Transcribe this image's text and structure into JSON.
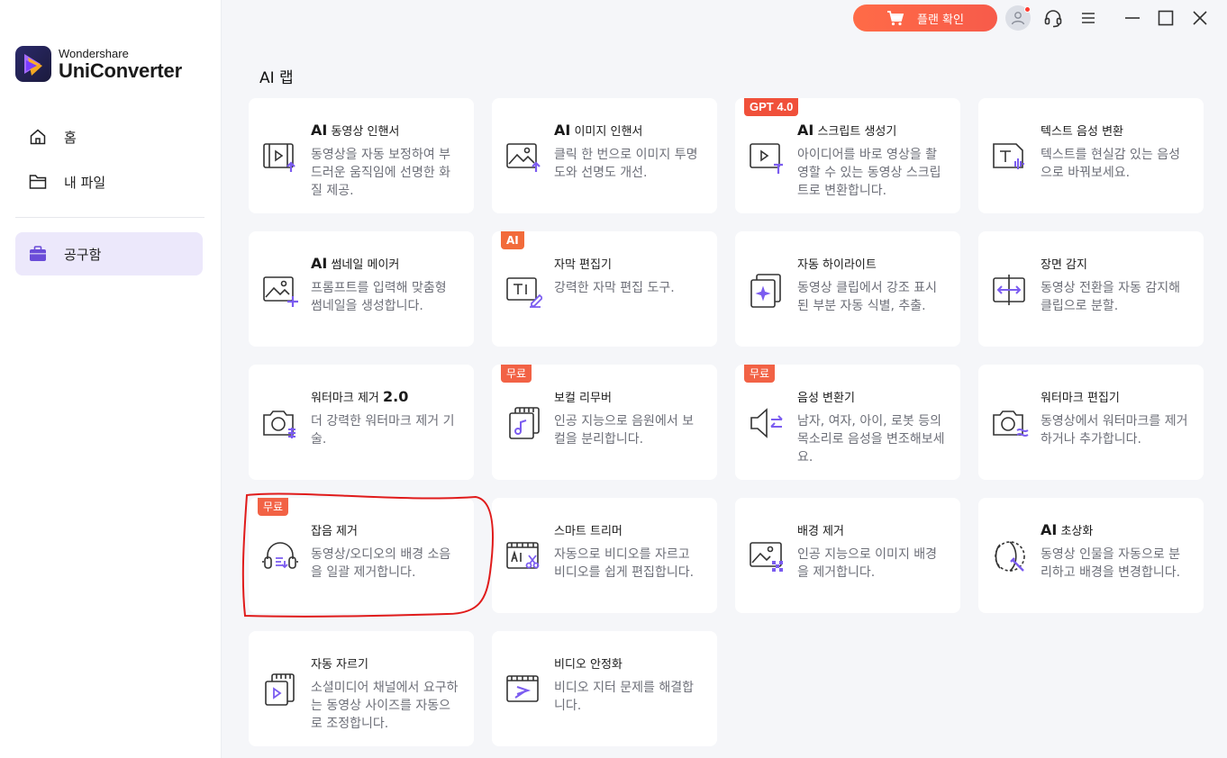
{
  "app": {
    "brand": "Wondershare",
    "product": "UniConverter"
  },
  "sidebar": {
    "items": [
      {
        "label": "홈",
        "icon": "home-icon"
      },
      {
        "label": "내 파일",
        "icon": "folder-icon"
      },
      {
        "label": "공구함",
        "icon": "toolbox-icon",
        "active": true
      }
    ]
  },
  "topbar": {
    "plan_label": "플랜 확인"
  },
  "section": {
    "title": "AI 랩"
  },
  "cards": [
    {
      "title_prefix": "AI",
      "title": " 동영상 인핸서",
      "desc": "동영상을 자동 보정하여 부드러운 움직임에 선명한 화질 제공.",
      "icon": "video-enhancer-icon"
    },
    {
      "title_prefix": "AI",
      "title": " 이미지 인핸서",
      "desc": "클릭 한 번으로 이미지 투명도와 선명도 개선.",
      "icon": "image-enhancer-icon"
    },
    {
      "title_prefix": "AI",
      "title": " 스크립트 생성기",
      "desc": "아이디어를 바로 영상을 촬영할 수 있는 동영상 스크립트로 변환합니다.",
      "icon": "script-generator-icon",
      "badge": "GPT 4.0"
    },
    {
      "title_prefix": "",
      "title": "텍스트 음성 변환",
      "desc": "텍스트를 현실감 있는 음성으로 바꿔보세요.",
      "icon": "text-to-speech-icon"
    },
    {
      "title_prefix": "AI",
      "title": " 썸네일 메이커",
      "desc": "프롬프트를 입력해 맞춤형 썸네일을 생성합니다.",
      "icon": "thumbnail-maker-icon"
    },
    {
      "title_prefix": "",
      "title": "자막 편집기",
      "desc": "강력한 자막 편집 도구.",
      "icon": "subtitle-editor-icon",
      "badge": "AI"
    },
    {
      "title_prefix": "",
      "title": "자동 하이라이트",
      "desc": "동영상 클립에서 강조 표시된 부분 자동 식별, 추출.",
      "icon": "auto-highlight-icon"
    },
    {
      "title_prefix": "",
      "title": "장면 감지",
      "desc": "동영상 전환을 자동 감지해 클립으로 분할.",
      "icon": "scene-detect-icon"
    },
    {
      "title_prefix": "",
      "title": "워터마크 제거 ",
      "title_suffix": "2.0",
      "desc": "더 강력한 워터마크 제거 기술.",
      "icon": "watermark-remover-icon"
    },
    {
      "title_prefix": "",
      "title": "보컬 리무버",
      "desc": "인공 지능으로 음원에서 보컬을 분리합니다.",
      "icon": "vocal-remover-icon",
      "badge": "무료"
    },
    {
      "title_prefix": "",
      "title": "음성 변환기",
      "desc": "남자, 여자, 아이, 로봇 등의 목소리로 음성을 변조해보세요.",
      "icon": "voice-changer-icon",
      "badge": "무료"
    },
    {
      "title_prefix": "",
      "title": "워터마크 편집기",
      "desc": "동영상에서 워터마크를 제거하거나 추가합니다.",
      "icon": "watermark-editor-icon"
    },
    {
      "title_prefix": "",
      "title": "잡음 제거",
      "desc": "동영상/오디오의 배경 소음을 일괄 제거합니다.",
      "icon": "noise-remover-icon",
      "badge": "무료"
    },
    {
      "title_prefix": "",
      "title": "스마트 트리머",
      "desc": "자동으로 비디오를 자르고 비디오를 쉽게 편집합니다.",
      "icon": "smart-trimmer-icon"
    },
    {
      "title_prefix": "",
      "title": "배경 제거",
      "desc": "인공 지능으로 이미지 배경을 제거합니다.",
      "icon": "background-remover-icon"
    },
    {
      "title_prefix": "AI",
      "title": " 초상화",
      "desc": "동영상 인물을 자동으로 분리하고 배경을 변경합니다.",
      "icon": "ai-portrait-icon"
    },
    {
      "title_prefix": "",
      "title": "자동 자르기",
      "desc": "소셜미디어 채널에서 요구하는 동영상 사이즈를 자동으로 조정합니다.",
      "icon": "auto-crop-icon"
    },
    {
      "title_prefix": "",
      "title": "비디오 안정화",
      "desc": "비디오 지터 문제를 해결합니다.",
      "icon": "video-stabilizer-icon"
    }
  ],
  "colors": {
    "accent": "#7b5cf0",
    "badge": "#f26245",
    "active_nav": "#ece8fb",
    "highlight": "#e01b1b"
  }
}
